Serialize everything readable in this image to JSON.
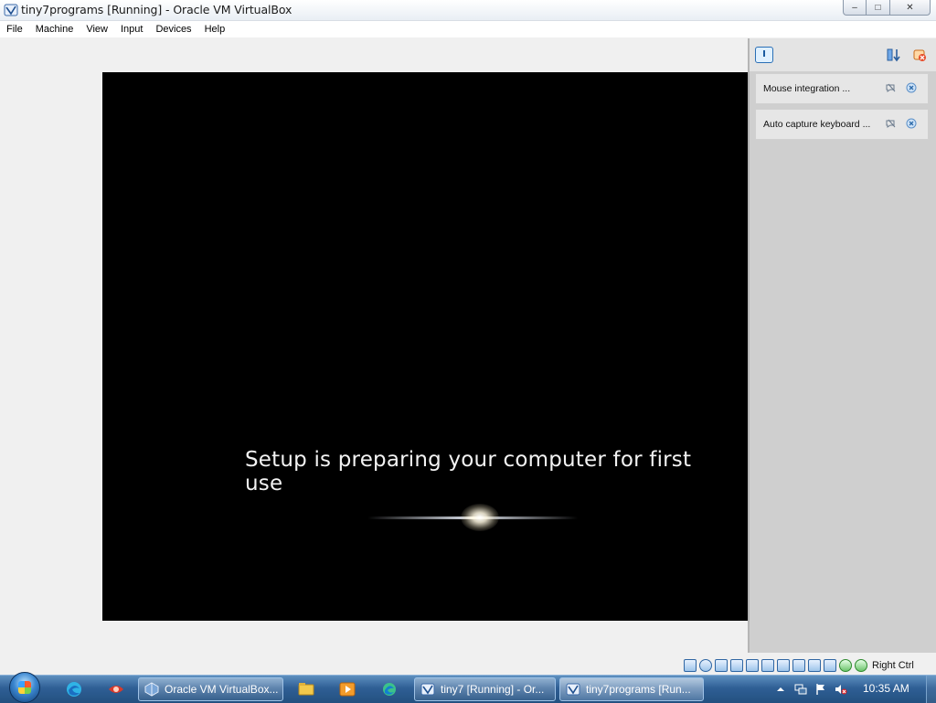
{
  "window": {
    "title": "tiny7programs [Running] - Oracle VM VirtualBox",
    "app_icon": "virtualbox-icon",
    "controls": {
      "minimize": "–",
      "maximize": "□",
      "close": "✕"
    }
  },
  "menubar": {
    "items": [
      "File",
      "Machine",
      "View",
      "Input",
      "Devices",
      "Help"
    ]
  },
  "vm": {
    "screen_text": "Setup is preparing your computer for first use"
  },
  "notifications": {
    "header_icons": [
      "notification-center-icon",
      "sort-icon",
      "clear-all-icon"
    ],
    "items": [
      {
        "text": "Mouse integration ...",
        "mute_icon": "mute-icon",
        "close_icon": "close-icon"
      },
      {
        "text": "Auto capture keyboard ...",
        "mute_icon": "mute-icon",
        "close_icon": "close-icon"
      }
    ]
  },
  "statusbar": {
    "icons": [
      "hard-disk-icon",
      "optical-drive-icon",
      "floppy-icon",
      "audio-icon",
      "network-icon",
      "usb-icon",
      "shared-folders-icon",
      "display-icon",
      "recording-icon",
      "cpu-icon",
      "mouse-integration-icon",
      "keyboard-icon"
    ],
    "host_key": "Right Ctrl"
  },
  "taskbar": {
    "pinned": [
      "edge-icon",
      "app-icon"
    ],
    "buttons": [
      {
        "label": "Oracle VM VirtualBox...",
        "icon": "virtualbox-icon"
      },
      {
        "label": "tiny7 [Running] - Or...",
        "icon": "virtualbox-icon"
      },
      {
        "label": "tiny7programs [Run...",
        "icon": "virtualbox-icon",
        "active": true
      }
    ],
    "pinned_extra": [
      "file-explorer-icon",
      "media-player-icon",
      "edge-icon"
    ],
    "tray": {
      "clock": "10:35 AM",
      "icons": [
        "show-hidden-icon",
        "network-icon",
        "action-center-flag-icon",
        "volume-muted-icon"
      ]
    }
  },
  "colors": {
    "accent": "#2f5f95",
    "vm_background": "#000000",
    "panel_background": "#cfcfcf"
  }
}
